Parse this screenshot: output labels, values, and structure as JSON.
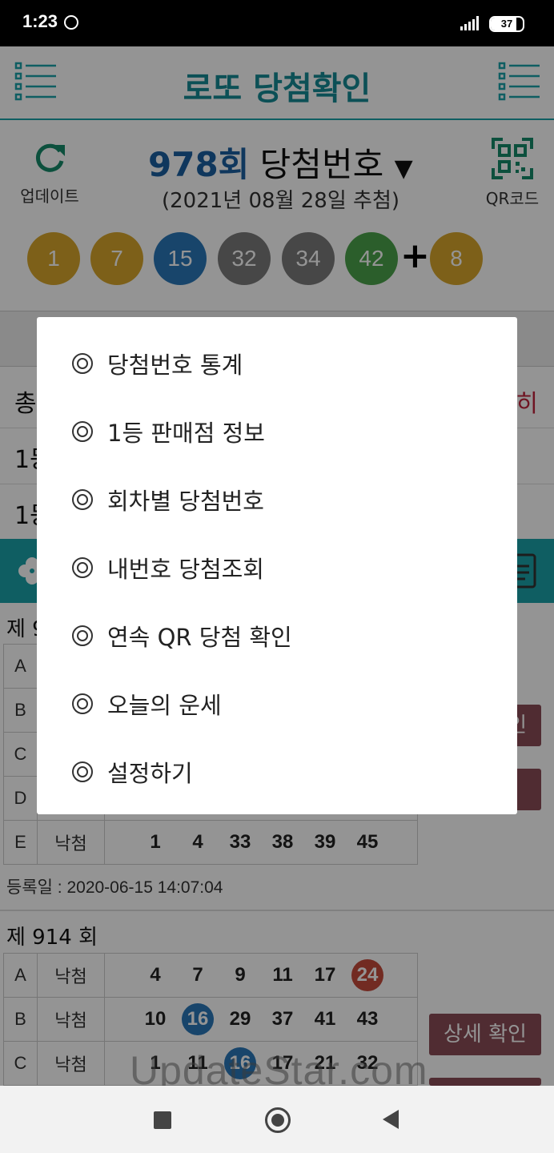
{
  "status": {
    "time": "1:23",
    "battery": "37"
  },
  "header": {
    "title": "로또 당첨확인"
  },
  "draw": {
    "round": "978회",
    "title_suffix": "당첨번호",
    "dropdown": "▼",
    "date": "(2021년 08월 28일 추첨)",
    "update_label": "업데이트",
    "qr_label": "QR코드",
    "balls": [
      {
        "number": "1",
        "color": "#d7a62b"
      },
      {
        "number": "7",
        "color": "#d7a62b"
      },
      {
        "number": "15",
        "color": "#2a78b8"
      },
      {
        "number": "32",
        "color": "#7a7a7a"
      },
      {
        "number": "34",
        "color": "#7a7a7a"
      },
      {
        "number": "42",
        "color": "#4aa34a"
      }
    ],
    "plus": "+",
    "bonus": {
      "number": "8",
      "color": "#d7a62b"
    }
  },
  "background_rows": [
    {
      "text": "총",
      "right": "히"
    },
    {
      "text": "1등",
      "right": ""
    },
    {
      "text": "1등",
      "right": ""
    }
  ],
  "ticket1": {
    "title": "제 9",
    "rows": [
      {
        "letter": "A",
        "result": "",
        "numbers": []
      },
      {
        "letter": "B",
        "result": "",
        "numbers": []
      },
      {
        "letter": "C",
        "result": "",
        "numbers": []
      },
      {
        "letter": "D",
        "result": "",
        "numbers": []
      },
      {
        "letter": "E",
        "result": "낙첨",
        "numbers": [
          "1",
          "4",
          "33",
          "38",
          "39",
          "45"
        ]
      }
    ],
    "side_button": "인",
    "registered": "등록일 : 2020-06-15 14:07:04"
  },
  "ticket2": {
    "title": "제 914 회",
    "rows": [
      {
        "letter": "A",
        "result": "낙첨",
        "numbers": [
          "4",
          "7",
          "9",
          "11",
          "17",
          "24"
        ],
        "hits": {
          "24": "#c44a3c"
        }
      },
      {
        "letter": "B",
        "result": "낙첨",
        "numbers": [
          "10",
          "16",
          "29",
          "37",
          "41",
          "43"
        ],
        "hits": {
          "16": "#2a78b8"
        }
      },
      {
        "letter": "C",
        "result": "낙첨",
        "numbers": [
          "1",
          "11",
          "16",
          "17",
          "21",
          "32"
        ],
        "hits": {
          "16": "#2a78b8"
        }
      }
    ],
    "side_button": "상세 확인"
  },
  "menu": {
    "items": [
      "당첨번호 통계",
      "1등 판매점 정보",
      "회차별 당첨번호",
      "내번호 당첨조회",
      "연속 QR 당첨 확인",
      "오늘의 운세",
      "설정하기"
    ]
  },
  "watermark": "UpdateStar.com",
  "colors": {
    "accent": "#1aa3aa",
    "title": "#168a94",
    "button": "#8a4d57"
  }
}
